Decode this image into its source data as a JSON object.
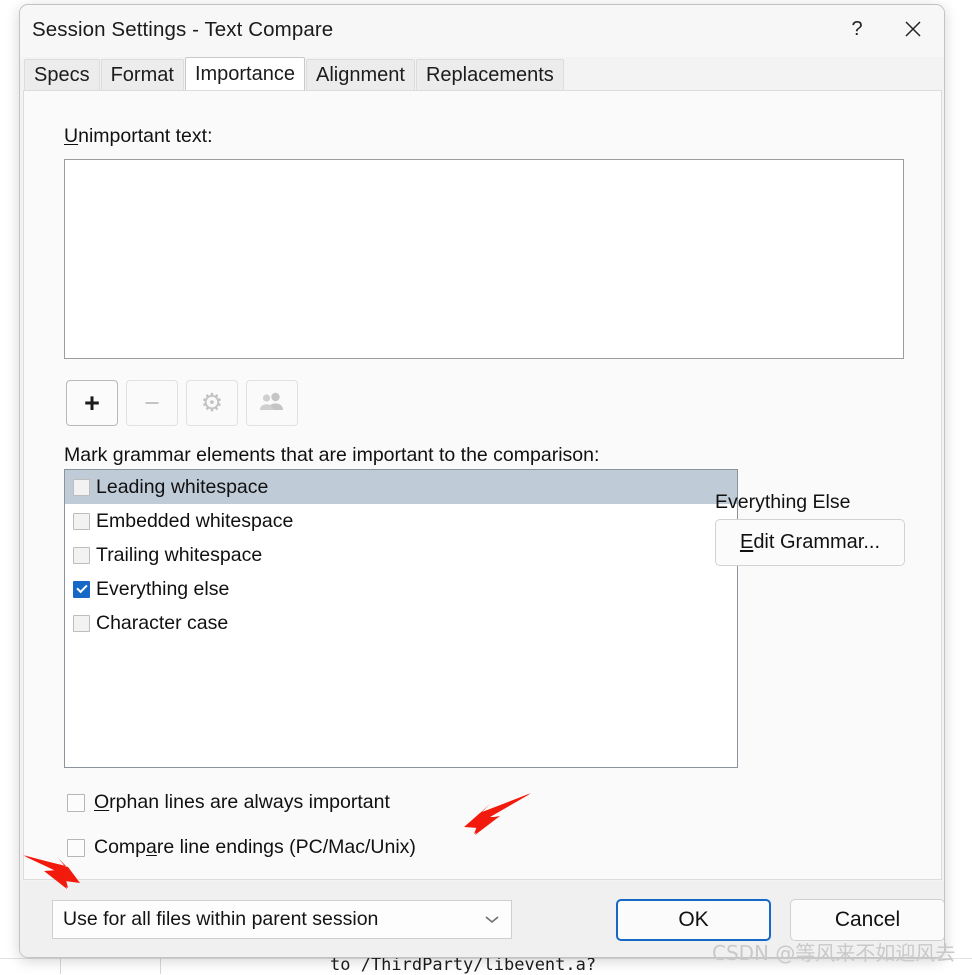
{
  "window": {
    "title": "Session Settings - Text Compare",
    "help_label": "?",
    "close_label": "✕"
  },
  "tabs": [
    {
      "label": "Specs",
      "active": false
    },
    {
      "label": "Format",
      "active": false
    },
    {
      "label": "Importance",
      "active": true
    },
    {
      "label": "Alignment",
      "active": false
    },
    {
      "label": "Replacements",
      "active": false
    }
  ],
  "importance_tab": {
    "unimportant_text_label": "Unimportant text:",
    "unimportant_text_accelerator": "U",
    "unimportant_text_value": "",
    "toolbar": [
      {
        "name": "add",
        "glyph": "＋",
        "enabled": true
      },
      {
        "name": "remove",
        "glyph": "−",
        "enabled": false
      },
      {
        "name": "settings",
        "glyph": "⚙",
        "enabled": false
      },
      {
        "name": "users",
        "glyph": "👥",
        "enabled": false
      }
    ],
    "grammar_label": "Mark grammar elements that are important to the comparison:",
    "grammar_items": [
      {
        "label": "Leading whitespace",
        "checked": false,
        "selected": true
      },
      {
        "label": "Embedded whitespace",
        "checked": false,
        "selected": false
      },
      {
        "label": "Trailing whitespace",
        "checked": false,
        "selected": false
      },
      {
        "label": "Everything else",
        "checked": true,
        "selected": false
      },
      {
        "label": "Character case",
        "checked": false,
        "selected": false
      }
    ],
    "grammar_side_label": "Everything Else",
    "edit_grammar_label": "Edit Grammar...",
    "edit_grammar_accelerator": "E",
    "options": [
      {
        "label": "Orphan lines are always important",
        "checked": false,
        "accelerator": "O",
        "accel_index": 0
      },
      {
        "label": "Compare line endings (PC/Mac/Unix)",
        "checked": false,
        "accelerator": "a",
        "accel_index": 4
      }
    ]
  },
  "footer": {
    "scope_selected": "Use for all files within parent session",
    "scope_chevron": "˅",
    "ok_label": "OK",
    "cancel_label": "Cancel"
  },
  "backdrop": {
    "code_lines": "}\n┐\n}\n┐\n}\n┐\n}\n┐\n}\n┐\n}\n┐\n}\n┐\n}\n┐\n}\n┐\n}\n┐\n}\n┐\n}\n┐\n}\n┐\n}\n┐\n}\n┐\n}\n┐\n}\n┐\n}\n┐\n}\n┐",
    "bottom_code": "to /ThirdParty/libevent.a?"
  },
  "watermark": {
    "text": "CSDN @等风来不如迎风去"
  },
  "colors": {
    "accent": "#1668c7",
    "selection": "#c0cbd8",
    "dialog_bg": "#f3f3f3",
    "annotation_red": "#f21a0c"
  }
}
